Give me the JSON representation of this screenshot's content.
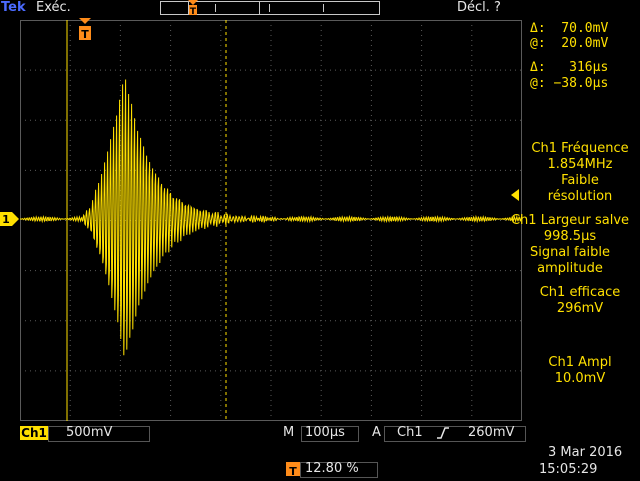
{
  "header": {
    "brand": "Tek",
    "run_status": "Exéc.",
    "trigger_status": "Décl. ?"
  },
  "cursors": {
    "voltage_delta": "Δ:  70.0mV",
    "voltage_at": "@:  20.0mV",
    "time_delta": "Δ:   316µs",
    "time_at": "@: −38.0µs"
  },
  "measurements": [
    {
      "lines": [
        "Ch1 Fréquence",
        "1.854MHz",
        "Faible",
        "résolution"
      ]
    },
    {
      "lines": [
        "Ch1 Largeur salve",
        "998.5µs",
        "Signal faible",
        "amplitude"
      ]
    },
    {
      "lines": [
        "Ch1 efficace",
        "296mV"
      ]
    },
    {
      "lines": [
        "Ch1 Ampl",
        "10.0mV"
      ]
    }
  ],
  "channel": {
    "badge": "Ch1",
    "scale": "500mV",
    "ground_marker": "1"
  },
  "timebase": {
    "m_label": "M",
    "scale": "100µs"
  },
  "trigger": {
    "a_label": "A",
    "source": "Ch1",
    "level": "260mV",
    "marker": "T"
  },
  "horizontal_position": {
    "marker": "T",
    "value": "12.80 %"
  },
  "datetime": {
    "date": "3 Mar  2016",
    "time": "15:05:29"
  },
  "colors": {
    "trace": "#ffe000",
    "trigger": "#ff8c1a",
    "brand": "#4b6bff",
    "text": "#e6e6e6",
    "grid": "#5a5a5a"
  },
  "icons": {
    "slope": "rising-edge-icon",
    "trigger_marker": "trigger-position-icon",
    "ground_marker": "channel-ground-marker-icon",
    "arrow": "left-arrow-icon"
  }
}
